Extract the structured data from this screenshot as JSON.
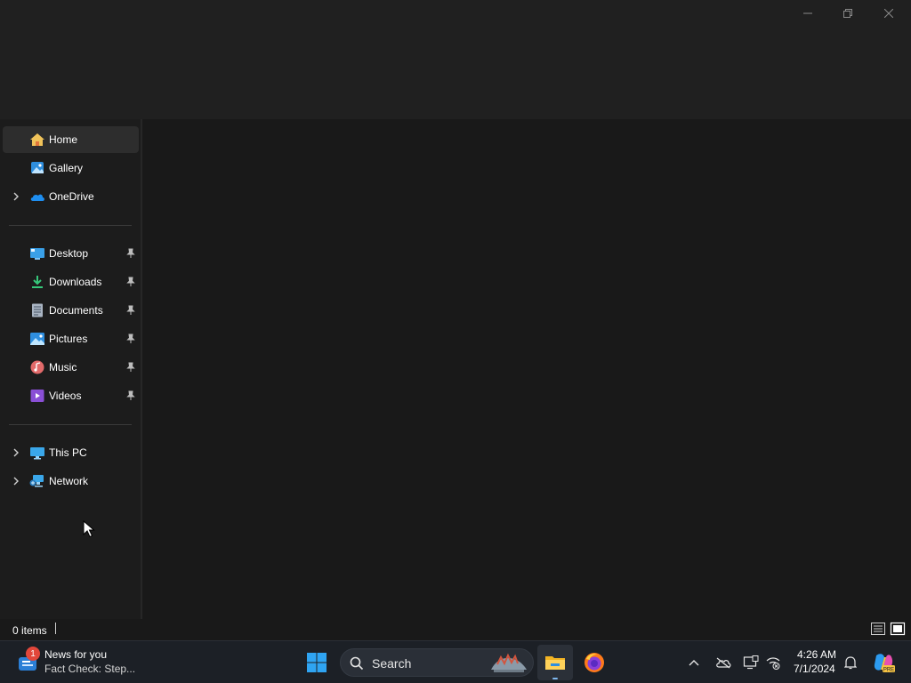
{
  "window": {
    "caption_icons": [
      "minimize-icon",
      "restore-icon",
      "close-icon"
    ]
  },
  "sidebar": {
    "top_items": [
      {
        "label": "Home",
        "icon": "home-icon",
        "selected": true,
        "expandable": false
      },
      {
        "label": "Gallery",
        "icon": "gallery-icon",
        "selected": false,
        "expandable": false
      },
      {
        "label": "OneDrive",
        "icon": "onedrive-icon",
        "selected": false,
        "expandable": true
      }
    ],
    "pinned_items": [
      {
        "label": "Desktop",
        "icon": "desktop-icon",
        "pinned": true
      },
      {
        "label": "Downloads",
        "icon": "downloads-icon",
        "pinned": true
      },
      {
        "label": "Documents",
        "icon": "documents-icon",
        "pinned": true
      },
      {
        "label": "Pictures",
        "icon": "pictures-icon",
        "pinned": true
      },
      {
        "label": "Music",
        "icon": "music-icon",
        "pinned": true
      },
      {
        "label": "Videos",
        "icon": "videos-icon",
        "pinned": true
      }
    ],
    "bottom_items": [
      {
        "label": "This PC",
        "icon": "this-pc-icon",
        "expandable": true
      },
      {
        "label": "Network",
        "icon": "network-icon",
        "expandable": true
      }
    ]
  },
  "status": {
    "items_count": "0 items",
    "view_icons": [
      "details-view-icon",
      "large-icons-view-icon"
    ]
  },
  "taskbar": {
    "news": {
      "badge": "1",
      "title": "News for you",
      "subtitle": "Fact Check: Step..."
    },
    "search": {
      "label": "Search"
    },
    "apps": [
      "start-icon",
      "file-explorer-icon",
      "firefox-icon"
    ],
    "tray_icons": [
      "chevron-up-icon",
      "onedrive-offline-icon",
      "display-icon",
      "network-disconnected-icon"
    ],
    "clock": {
      "time": "4:26 AM",
      "date": "7/1/2024"
    },
    "notification_icon": "bell-icon",
    "copilot_badge": "PRE"
  },
  "colors": {
    "window_bg": "#191919",
    "titlebar_bg": "#202020",
    "selected_bg": "#2d2d2d",
    "taskbar_bg": "#1c2026",
    "accent": "#0078d4"
  }
}
